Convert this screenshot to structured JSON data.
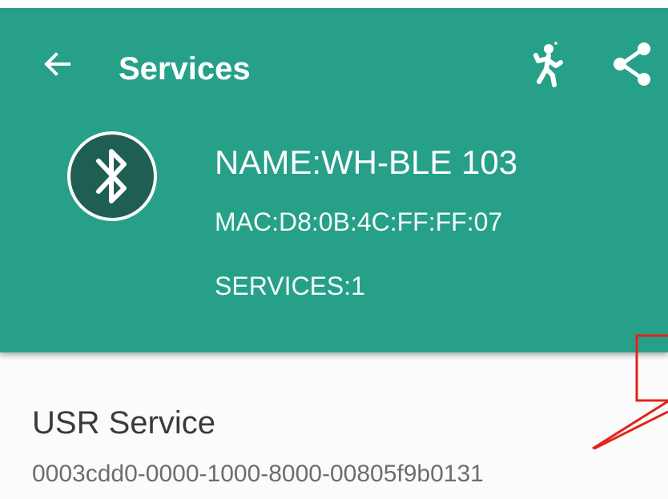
{
  "app_bar": {
    "title": "Services",
    "back_icon": "arrow-left-icon",
    "actions": [
      {
        "icon": "walking-person-icon"
      },
      {
        "icon": "share-icon"
      }
    ]
  },
  "device": {
    "icon": "bluetooth-icon",
    "name": "NAME:WH-BLE 103",
    "mac": "MAC:D8:0B:4C:FF:FF:07",
    "services": "SERVICES:1"
  },
  "service_list": [
    {
      "name": "USR Service",
      "uuid": "0003cdd0-0000-1000-8000-00805f9b0131"
    }
  ],
  "colors": {
    "header": "#27a089",
    "badge": "#1f5f53",
    "annotation": "#e2231a"
  }
}
